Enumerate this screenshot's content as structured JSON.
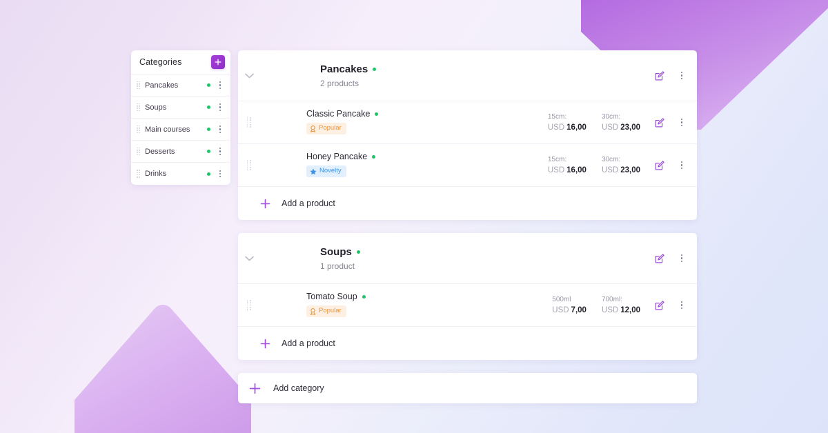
{
  "sidebar": {
    "title": "Categories",
    "add_button_icon": "plus-icon",
    "items": [
      {
        "label": "Pancakes",
        "status": "active"
      },
      {
        "label": "Soups",
        "status": "active"
      },
      {
        "label": "Main courses",
        "status": "active"
      },
      {
        "label": "Desserts",
        "status": "active"
      },
      {
        "label": "Drinks",
        "status": "active"
      }
    ]
  },
  "colors": {
    "accent": "#8d2fc7",
    "status_active": "#21c36a",
    "badge_popular_bg": "#fdf0e2",
    "badge_popular_fg": "#e8953c",
    "badge_novelty_bg": "#e2effc",
    "badge_novelty_fg": "#3f93e3",
    "card_bg": "#ffffff"
  },
  "categories": [
    {
      "name": "Pancakes",
      "count_label": "2 products",
      "image": "pancake-stack-photo",
      "add_product_label": "Add a product",
      "products": [
        {
          "name": "Classic Pancake",
          "image": "classic-pancake-photo",
          "badge": {
            "label": "Popular",
            "type": "popular",
            "icon": "award-icon"
          },
          "prices": [
            {
              "size": "15cm:",
              "currency": "USD",
              "amount": "16,00"
            },
            {
              "size": "30cm:",
              "currency": "USD",
              "amount": "23,00"
            }
          ]
        },
        {
          "name": "Honey Pancake",
          "image": "honey-pancake-photo",
          "badge": {
            "label": "Novelty",
            "type": "novelty",
            "icon": "star-icon"
          },
          "prices": [
            {
              "size": "15cm:",
              "currency": "USD",
              "amount": "16,00"
            },
            {
              "size": "30cm:",
              "currency": "USD",
              "amount": "23,00"
            }
          ]
        }
      ]
    },
    {
      "name": "Soups",
      "count_label": "1 product",
      "image": "soup-bowl-photo",
      "add_product_label": "Add a product",
      "products": [
        {
          "name": "Tomato Soup",
          "image": "tomato-soup-photo",
          "badge": {
            "label": "Popular",
            "type": "popular",
            "icon": "award-icon"
          },
          "prices": [
            {
              "size": "500ml",
              "currency": "USD",
              "amount": "7,00"
            },
            {
              "size": "700ml:",
              "currency": "USD",
              "amount": "12,00"
            }
          ]
        }
      ]
    }
  ],
  "add_category": {
    "label": "Add category",
    "icon": "plus-icon"
  },
  "row_actions": {
    "edit_icon": "edit-pencil-icon",
    "more_icon": "kebab-menu-icon"
  }
}
